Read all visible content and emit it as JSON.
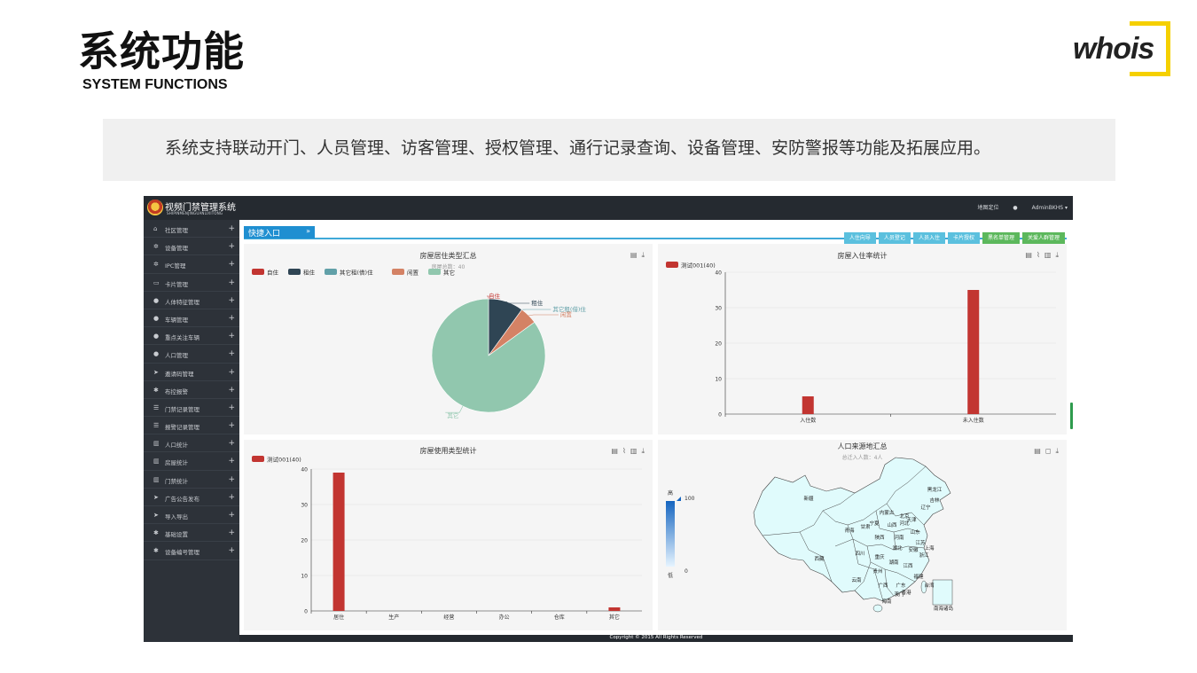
{
  "slide": {
    "title": "系统功能",
    "subtitle": "SYSTEM FUNCTIONS",
    "logo_text": "whois",
    "description": "系统支持联动开门、人员管理、访客管理、授权管理、通行记录查询、设备管理、安防警报等功能及拓展应用。"
  },
  "app": {
    "name": "视频门禁管理系统",
    "name_sub": "SHIPINMENJINGUANLIXITONG",
    "top_links": [
      "地图定位",
      "AdminBKHS"
    ],
    "sidebar": [
      {
        "icon": "home-icon",
        "glyph": "⌂",
        "label": "社区管理"
      },
      {
        "icon": "gears-icon",
        "glyph": "✲",
        "label": "设备管理"
      },
      {
        "icon": "gears-icon",
        "glyph": "✲",
        "label": "IPC管理"
      },
      {
        "icon": "card-icon",
        "glyph": "▭",
        "label": "卡片管理"
      },
      {
        "icon": "user-icon",
        "glyph": "●",
        "label": "人体特征管理"
      },
      {
        "icon": "users-icon",
        "glyph": "●",
        "label": "车辆管理"
      },
      {
        "icon": "users-icon",
        "glyph": "●",
        "label": "重点关注车辆"
      },
      {
        "icon": "users-icon",
        "glyph": "●",
        "label": "人口管理"
      },
      {
        "icon": "send-icon",
        "glyph": "➤",
        "label": "邀请码管理"
      },
      {
        "icon": "cog-icon",
        "glyph": "✱",
        "label": "布控报警"
      },
      {
        "icon": "list-icon",
        "glyph": "☰",
        "label": "门禁记录管理"
      },
      {
        "icon": "list-icon",
        "glyph": "☰",
        "label": "报警记录管理"
      },
      {
        "icon": "chart-icon",
        "glyph": "▥",
        "label": "人口统计"
      },
      {
        "icon": "chart-icon",
        "glyph": "▥",
        "label": "房屋统计"
      },
      {
        "icon": "chart-icon",
        "glyph": "▥",
        "label": "门禁统计"
      },
      {
        "icon": "send-icon",
        "glyph": "➤",
        "label": "广告公告发布"
      },
      {
        "icon": "send-icon",
        "glyph": "➤",
        "label": "导入导出"
      },
      {
        "icon": "cog-icon",
        "glyph": "✱",
        "label": "基础设置"
      },
      {
        "icon": "cog-icon",
        "glyph": "✱",
        "label": "设备编号管理"
      }
    ],
    "quick_entry": "快捷入口",
    "quick_buttons": [
      {
        "label": "人住向导",
        "color": "#5bc0de"
      },
      {
        "label": "人员登记",
        "color": "#5bc0de"
      },
      {
        "label": "人员入住",
        "color": "#5bc0de"
      },
      {
        "label": "卡片授权",
        "color": "#5bc0de"
      },
      {
        "label": "黑名单管理",
        "color": "#5cb85c"
      },
      {
        "label": "关爱人群管理",
        "color": "#5cb85c"
      }
    ],
    "footer": "Copyright © 2015 All Rights Reserved"
  },
  "chart_data": [
    {
      "type": "pie",
      "title": "房屋居住类型汇总",
      "subtitle": "房屋总数：40",
      "legend_position": "top-left",
      "slices": [
        {
          "name": "自住",
          "value": 0,
          "color": "#c23531"
        },
        {
          "name": "租住",
          "value": 4,
          "color": "#2f4554"
        },
        {
          "name": "其它租(借)住",
          "value": 0,
          "color": "#61a0a8"
        },
        {
          "name": "闲置",
          "value": 2,
          "color": "#d48265"
        },
        {
          "name": "其它",
          "value": 34,
          "color": "#91c7ae"
        }
      ]
    },
    {
      "type": "bar",
      "title": "房屋入住率统计",
      "series": [
        {
          "name": "测试001(40)",
          "values": [
            5,
            35
          ],
          "color": "#c23531"
        }
      ],
      "categories": [
        "入住数",
        "未入住数"
      ],
      "ylim": [
        0,
        40
      ],
      "yticks": [
        0,
        10,
        20,
        30,
        40
      ],
      "legend_position": "top-left"
    },
    {
      "type": "bar",
      "title": "房屋使用类型统计",
      "series": [
        {
          "name": "测试001(40)",
          "values": [
            39,
            0,
            0,
            0,
            0,
            1
          ],
          "color": "#c23531"
        }
      ],
      "categories": [
        "居住",
        "生产",
        "经营",
        "办公",
        "仓库",
        "其它"
      ],
      "ylim": [
        0,
        40
      ],
      "yticks": [
        0,
        10,
        20,
        30,
        40
      ],
      "legend_position": "top-left"
    },
    {
      "type": "map",
      "title": "人口来源地汇总",
      "subtitle": "总迁入人数：4人",
      "visual_map": {
        "high_label": "高",
        "low_label": "低",
        "max": 100,
        "min": 0
      },
      "regions": [
        "新疆",
        "西藏",
        "青海",
        "甘肃",
        "内蒙古",
        "黑龙江",
        "吉林",
        "辽宁",
        "北京",
        "天津",
        "河北",
        "山西",
        "陕西",
        "宁夏",
        "山东",
        "河南",
        "江苏",
        "上海",
        "安徽",
        "湖北",
        "四川",
        "重庆",
        "浙江",
        "湖南",
        "江西",
        "贵州",
        "云南",
        "福建",
        "广西",
        "广东",
        "台湾",
        "海南",
        "香港",
        "澳门",
        "南海诸岛"
      ]
    }
  ]
}
